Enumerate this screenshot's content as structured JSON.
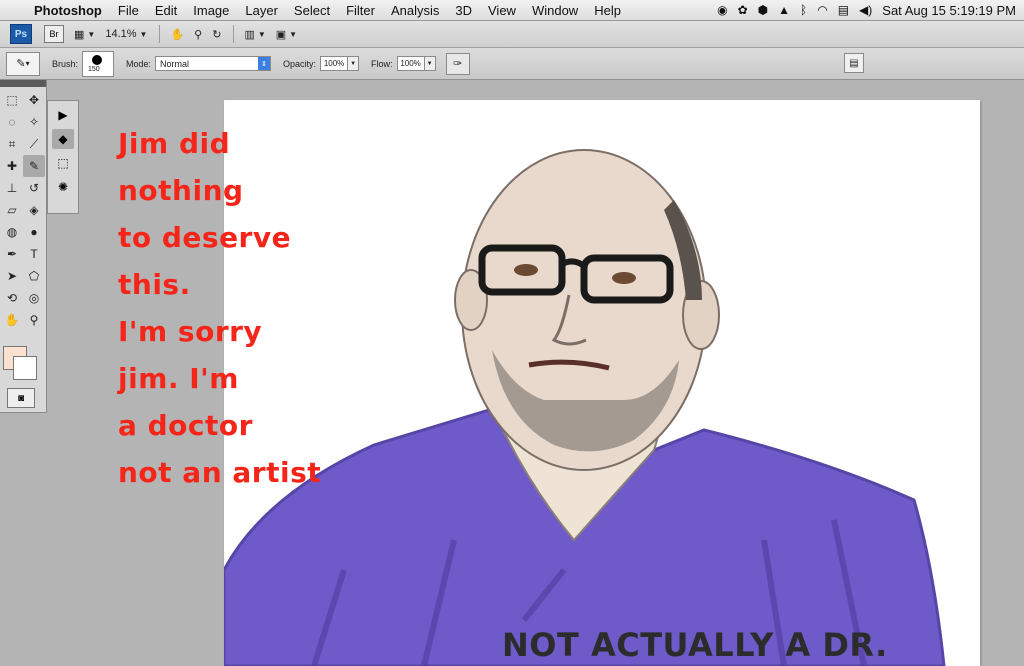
{
  "menubar": {
    "app_name": "Photoshop",
    "items": [
      "File",
      "Edit",
      "Image",
      "Layer",
      "Select",
      "Filter",
      "Analysis",
      "3D",
      "View",
      "Window",
      "Help"
    ],
    "status_icons": [
      "nvidia-icon",
      "paw-icon",
      "hexagon-icon",
      "upload-icon",
      "bluetooth-icon",
      "wifi-icon",
      "us-flag-icon",
      "volume-icon"
    ],
    "datetime": "Sat Aug 15  5:19:19 PM"
  },
  "appbar": {
    "ps_badge": "Ps",
    "br_badge": "Br",
    "zoom": "14.1%"
  },
  "options": {
    "brush_label": "Brush:",
    "brush_size": "150",
    "mode_label": "Mode:",
    "mode_value": "Normal",
    "opacity_label": "Opacity:",
    "opacity_value": "100%",
    "flow_label": "Flow:",
    "flow_value": "100%"
  },
  "colors": {
    "foreground": "#fbe1cf",
    "background": "#ffffff",
    "caption_red": "#f5251a",
    "shirt_purple": "#6e5ac8"
  },
  "caption": {
    "lines": [
      "Jim did",
      "nothing",
      "to deserve",
      "this.",
      "I'm sorry",
      "jim. I'm",
      "a doctor",
      "not an artist"
    ]
  },
  "footer_note": "NOT ACTUALLY A DR."
}
